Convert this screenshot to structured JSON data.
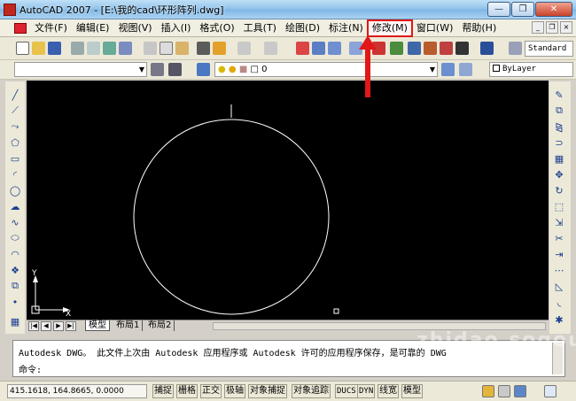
{
  "window": {
    "title": "AutoCAD 2007 - [E:\\我的cad\\环形阵列.dwg]",
    "controls": [
      "—",
      "❐",
      "✕"
    ]
  },
  "menu": {
    "items": [
      {
        "label": "文件(F)"
      },
      {
        "label": "编辑(E)"
      },
      {
        "label": "视图(V)"
      },
      {
        "label": "插入(I)"
      },
      {
        "label": "格式(O)"
      },
      {
        "label": "工具(T)"
      },
      {
        "label": "绘图(D)"
      },
      {
        "label": "标注(N)"
      },
      {
        "label": "修改(M)",
        "highlighted": true
      },
      {
        "label": "窗口(W)"
      },
      {
        "label": "帮助(H)"
      }
    ]
  },
  "toolbar": {
    "text_style": "Standard",
    "layer_value": "0",
    "color_value": "ByLayer"
  },
  "layout_tabs": {
    "items": [
      "模型",
      "布局1",
      "布局2"
    ],
    "active": "模型"
  },
  "command": {
    "history": "Autodesk DWG。  此文件上次由 Autodesk 应用程序或 Autodesk 许可的应用程序保存，是可靠的 DWG",
    "prompt": "命令:"
  },
  "status": {
    "coordinates": "415.1618, 164.8665, 0.0000",
    "toggles": [
      "捕捉",
      "栅格",
      "正交",
      "极轴",
      "对象捕捉",
      "对象追踪",
      "DUCS",
      "DYN",
      "线宽",
      "模型"
    ]
  },
  "ucs": {
    "x_label": "X",
    "y_label": "Y"
  },
  "colors": {
    "canvas": "#000000",
    "drawing": "#ffffff",
    "highlight": "#e01818"
  },
  "watermark": "zhidao.sogou.com"
}
